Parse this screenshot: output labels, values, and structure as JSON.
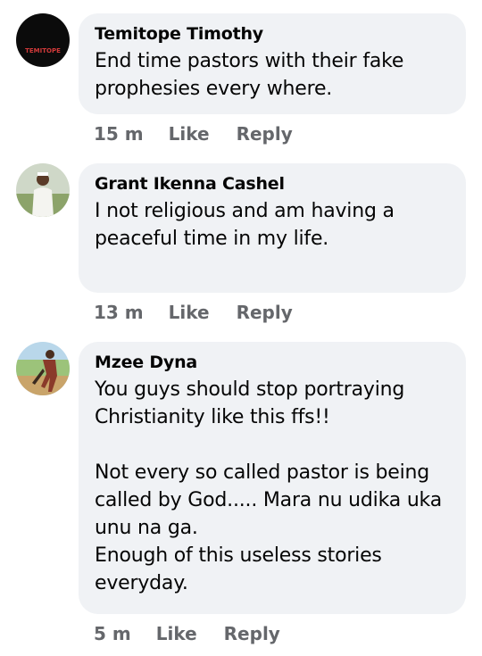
{
  "comments": [
    {
      "author": "Temitope Timothy",
      "avatar_text": "TEMITOPE",
      "text": "End time pastors with their fake prophesies every where.",
      "time": "15 m",
      "like": "Like",
      "reply": "Reply"
    },
    {
      "author": "Grant Ikenna Cashel",
      "text": "I not religious and am having a peaceful time in my life.",
      "time": "13 m",
      "like": "Like",
      "reply": "Reply"
    },
    {
      "author": "Mzee Dyna",
      "text": "You guys should stop portraying Christianity like this ffs!!\n\nNot every so called pastor is being called by God..... Mara nu udika uka unu na ga.\nEnough of this useless stories everyday.",
      "time": "5 m",
      "like": "Like",
      "reply": "Reply"
    }
  ]
}
